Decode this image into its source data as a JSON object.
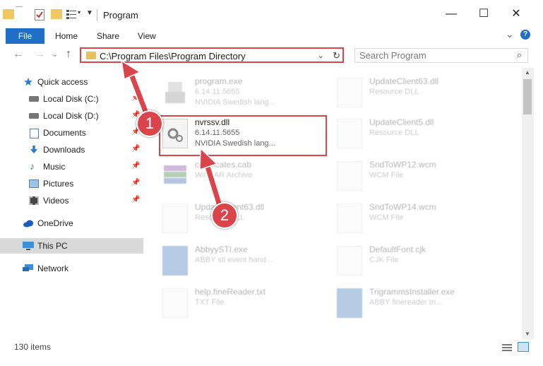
{
  "window": {
    "title": "Program",
    "minimize_glyph": "—",
    "maximize_glyph": "☐",
    "close_glyph": "✕"
  },
  "ribbon": {
    "tabs": [
      "File",
      "Home",
      "Share",
      "View"
    ],
    "collapse_glyph": "⌄",
    "help_glyph": "?"
  },
  "nav": {
    "back_glyph": "←",
    "forward_glyph": "→",
    "recent_glyph": "⌄",
    "up_glyph": "↑",
    "address": "C:\\Program Files\\Program Directory",
    "search_placeholder": "Search Program"
  },
  "sidebar": {
    "items": [
      {
        "label": "Quick access",
        "icon": "star-icon"
      },
      {
        "label": "Local Disk (C:)",
        "icon": "drive-icon",
        "pinned": true
      },
      {
        "label": "Local Disk (D:)",
        "icon": "drive-icon",
        "pinned": true
      },
      {
        "label": "Documents",
        "icon": "documents-icon",
        "pinned": true
      },
      {
        "label": "Downloads",
        "icon": "downloads-icon",
        "pinned": true
      },
      {
        "label": "Music",
        "icon": "music-icon",
        "pinned": true
      },
      {
        "label": "Pictures",
        "icon": "pictures-icon",
        "pinned": true
      },
      {
        "label": "Videos",
        "icon": "videos-icon",
        "pinned": true
      },
      {
        "label": "OneDrive",
        "icon": "cloud-icon"
      },
      {
        "label": "This PC",
        "icon": "computer-icon",
        "selected": true
      },
      {
        "label": "Network",
        "icon": "network-icon"
      }
    ]
  },
  "files": [
    {
      "name": "program.exe",
      "line1": "6.14.11.5655",
      "line2": "NVIDIA Swedish lang...",
      "icon": "exe-icon"
    },
    {
      "name": "UpdateClient63.dll",
      "line1": "Resource DLL",
      "line2": "",
      "icon": "dll-icon"
    },
    {
      "name": "nvrssv.dll",
      "line1": "6.14.11.5655",
      "line2": "NVIDIA Swedish lang...",
      "icon": "gear-dll-icon"
    },
    {
      "name": "UpdateClient5.dll",
      "line1": "Resource DLL",
      "line2": "",
      "icon": "dll-icon"
    },
    {
      "name": "certificates.cab",
      "line1": "WinRAR Archive",
      "line2": "",
      "icon": "archive-icon"
    },
    {
      "name": "SndToWP12.wcm",
      "line1": "WCM File",
      "line2": "",
      "icon": "file-icon"
    },
    {
      "name": "UpdateClient63.dll",
      "line1": "Resource DLL",
      "line2": "",
      "icon": "dll-icon"
    },
    {
      "name": "SndToWP14.wcm",
      "line1": "WCM File",
      "line2": "",
      "icon": "file-icon"
    },
    {
      "name": "AbbyySTI.exe",
      "line1": "ABBY sti event hand...",
      "line2": "",
      "icon": "app-icon"
    },
    {
      "name": "DefaultFont.cjk",
      "line1": "CJK File",
      "line2": "",
      "icon": "file-icon"
    },
    {
      "name": "help.fineReader.txt",
      "line1": "TXT File",
      "line2": "",
      "icon": "text-file-icon"
    },
    {
      "name": "TrigrammsInstaller.exe",
      "line1": "ABBY finereader tri...",
      "line2": "",
      "icon": "app-icon"
    }
  ],
  "status": {
    "item_count": "130 items"
  },
  "annotations": {
    "step1": "1",
    "step2": "2"
  },
  "colors": {
    "accent": "#1f6fc6",
    "highlight_red": "#d9454a",
    "selection": "#d9d9d9"
  }
}
